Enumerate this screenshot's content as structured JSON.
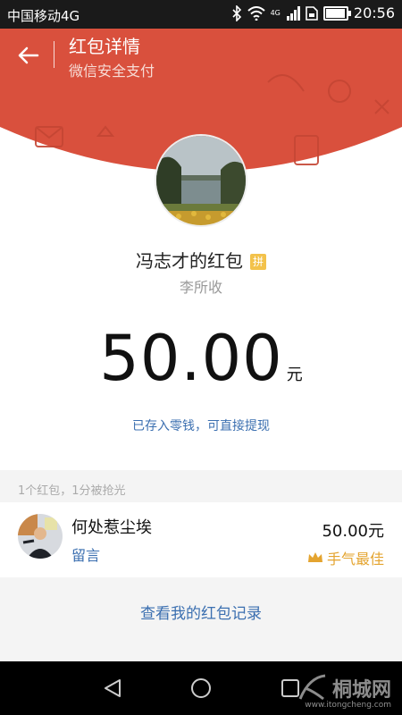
{
  "status_bar": {
    "carrier": "中国移动4G",
    "network_tag": "4G",
    "time": "20:56",
    "battery_level": 0.9
  },
  "header": {
    "title": "红包详情",
    "subtitle": "微信安全支付",
    "back_icon": "arrow-left-icon",
    "background_color": "#d9503d"
  },
  "packet": {
    "owner_label": "冯志才的红包",
    "pin_badge": "拼",
    "sender": "李所收",
    "amount": "50.00",
    "unit": "元",
    "note": "已存入零钱，可直接提现"
  },
  "summary": {
    "text": "1个红包，1分被抢光"
  },
  "receivers": [
    {
      "name": "何处惹尘埃",
      "message": "留言",
      "amount": "50.00元",
      "best_luck": "手气最佳"
    }
  ],
  "records_link": "查看我的红包记录",
  "navigation": {
    "back": "triangle-back-icon",
    "home": "circle-home-icon",
    "recent": "square-recent-icon"
  },
  "watermark": {
    "text": "桐城网",
    "url": "www.itongcheng.com"
  },
  "colors": {
    "accent_red": "#d9503d",
    "link_blue": "#3b6fb0",
    "gold": "#e4a42f"
  }
}
